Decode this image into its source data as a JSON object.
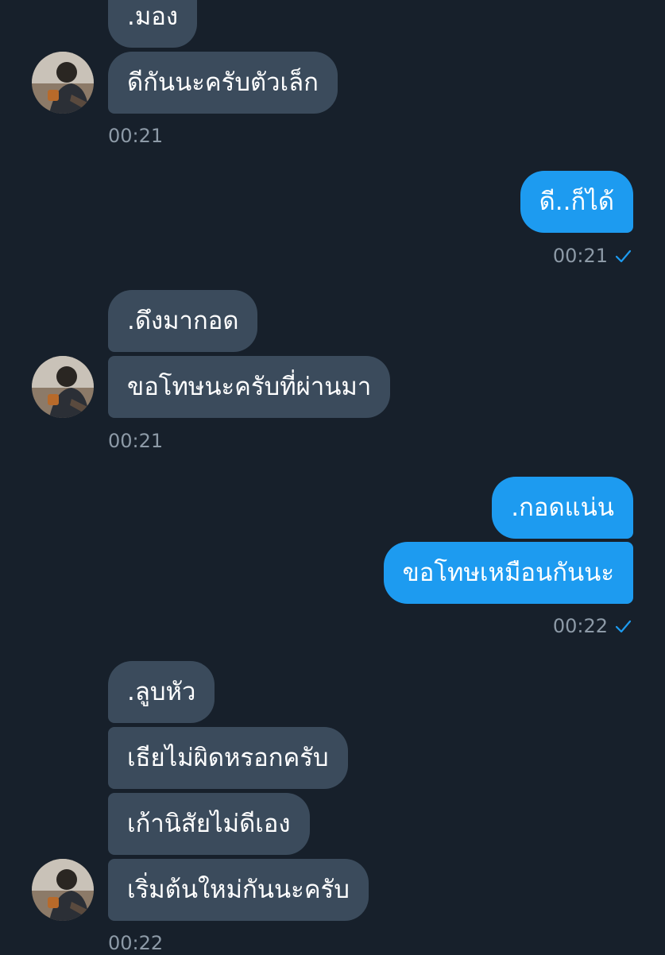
{
  "messages": [
    {
      "text": ".มอง"
    },
    {
      "text": "ดีกันนะครับตัวเล็ก"
    },
    {
      "text": "ดี..ก็ได้"
    },
    {
      "text": ".ดึงมากอด"
    },
    {
      "text": "ขอโทษนะครับที่ผ่านมา"
    },
    {
      "text": ".กอดแน่น"
    },
    {
      "text": "ขอโทษเหมือนกันนะ"
    },
    {
      "text": ".ลูบหัว"
    },
    {
      "text": "เธียไม่ผิดหรอกครับ"
    },
    {
      "text": "เก้านิสัยไม่ดีเอง"
    },
    {
      "text": "เริ่มต้นใหม่กันนะครับ"
    }
  ],
  "timestamps": [
    "00:21",
    "00:21",
    "00:21",
    "00:22",
    "00:22"
  ],
  "colors": {
    "background": "#17202b",
    "incoming_bubble": "#3b4b5c",
    "outgoing_bubble": "#1d9bf0",
    "timestamp": "#8d9aa7",
    "read_check": "#1d9bf0"
  },
  "icons": {
    "read_receipt": "checkmark-icon",
    "avatar": "user-avatar"
  }
}
